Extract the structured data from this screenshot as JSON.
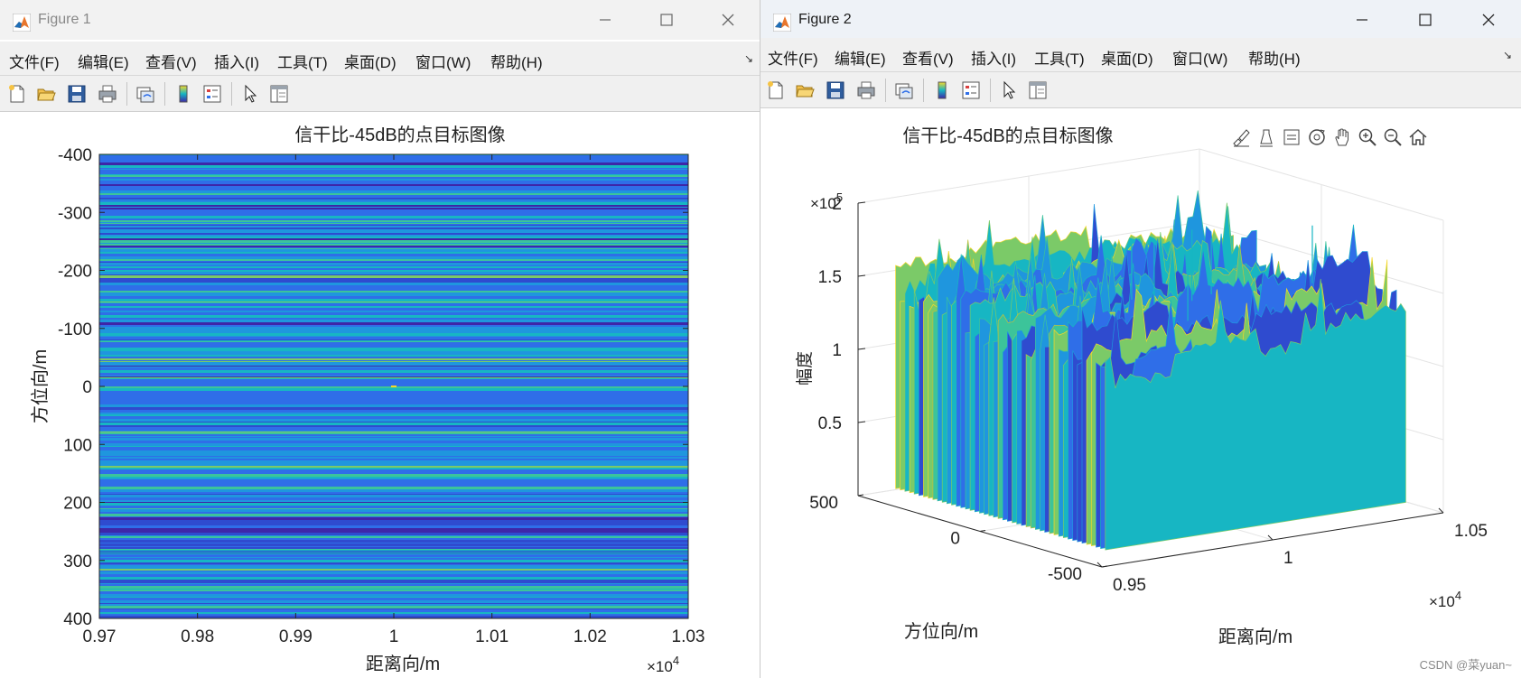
{
  "figure1": {
    "title": "Figure 1",
    "menu": [
      "文件(F)",
      "编辑(E)",
      "查看(V)",
      "插入(I)",
      "工具(T)",
      "桌面(D)",
      "窗口(W)",
      "帮助(H)"
    ],
    "toolbar_icons": [
      "new-figure-icon",
      "open-file-icon",
      "save-icon",
      "print-icon",
      "link-plot-icon",
      "colorbar-icon",
      "legend-icon",
      "edit-plot-icon",
      "property-inspector-icon"
    ],
    "plot": {
      "title": "信干比-45dB的点目标图像",
      "xlabel": "距离向/m",
      "ylabel": "方位向/m",
      "x_ticks": [
        "0.97",
        "0.98",
        "0.99",
        "1",
        "1.01",
        "1.02",
        "1.03"
      ],
      "y_ticks": [
        "-400",
        "-300",
        "-200",
        "-100",
        "0",
        "100",
        "200",
        "300",
        "400"
      ],
      "x_exponent_base": "×10",
      "x_exponent_power": "4"
    }
  },
  "figure2": {
    "title": "Figure 2",
    "menu": [
      "文件(F)",
      "编辑(E)",
      "查看(V)",
      "插入(I)",
      "工具(T)",
      "桌面(D)",
      "窗口(W)",
      "帮助(H)"
    ],
    "toolbar_icons": [
      "new-figure-icon",
      "open-file-icon",
      "save-icon",
      "print-icon",
      "link-plot-icon",
      "colorbar-icon",
      "legend-icon",
      "edit-plot-icon",
      "property-inspector-icon"
    ],
    "axes_toolbar_icons": [
      "brush-icon",
      "data-tips-icon",
      "data-cursor-icon",
      "rotate-3d-icon",
      "pan-icon",
      "zoom-in-icon",
      "zoom-out-icon",
      "home-icon"
    ],
    "plot": {
      "title": "信干比-45dB的点目标图像",
      "xlabel": "距离向/m",
      "ylabel": "方位向/m",
      "zlabel": "幅度",
      "z_ticks": [
        "0.5",
        "1",
        "1.5",
        "2"
      ],
      "z_exponent_base": "×10",
      "z_exponent_power": "5",
      "x_ticks": [
        "0.95",
        "1",
        "1.05"
      ],
      "x_exponent_base": "×10",
      "x_exponent_power": "4",
      "y_ticks": [
        "500",
        "0",
        "-500"
      ]
    }
  },
  "watermark": "CSDN @菜yuan~",
  "chart_data": [
    {
      "type": "heatmap",
      "title": "信干比-45dB的点目标图像",
      "xlabel": "距离向/m",
      "ylabel": "方位向/m",
      "xlim": [
        9700,
        10300
      ],
      "ylim": [
        -400,
        400
      ],
      "y_reversed": true,
      "pattern": "horizontal stripes across the full range direction, blue/cyan/green parula colours",
      "point_target": [
        10000,
        0
      ],
      "colormap": [
        "#3e26a8",
        "#2f4bcf",
        "#2f6ee8",
        "#1f96de",
        "#17b6c3",
        "#3cc49a",
        "#7bca68",
        "#c1c13c",
        "#f5d72a"
      ]
    },
    {
      "type": "surface",
      "title": "信干比-45dB的点目标图像",
      "xlabel": "距离向/m",
      "ylabel": "方位向/m",
      "zlabel": "幅度",
      "xlim": [
        9500,
        10500
      ],
      "ylim": [
        -500,
        500
      ],
      "zlim": [
        0,
        200000
      ],
      "peak_z": 190000,
      "typical_z_range": [
        70000,
        150000
      ],
      "colormap": [
        "#3e26a8",
        "#2f4bcf",
        "#2f6ee8",
        "#1f96de",
        "#17b6c3",
        "#3cc49a",
        "#7bca68",
        "#c1c13c",
        "#f5d72a"
      ]
    }
  ]
}
